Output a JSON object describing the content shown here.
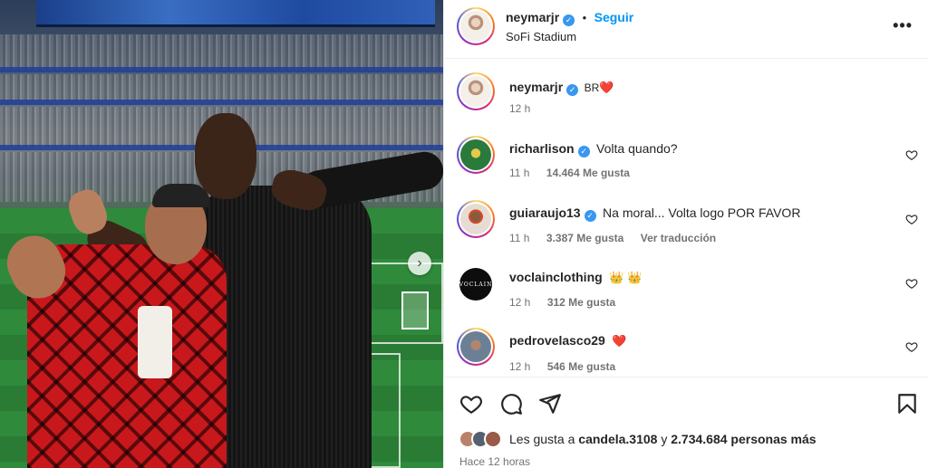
{
  "header": {
    "username": "neymarjr",
    "separator": "•",
    "follow_label": "Seguir",
    "location": "SoFi Stadium",
    "more_icon": "more-horizontal-icon"
  },
  "caption": {
    "username": "neymarjr",
    "text": "BR",
    "emoji": "❤️",
    "time": "12 h"
  },
  "comments": [
    {
      "username": "richarlison",
      "verified": true,
      "text": "Volta quando?",
      "time": "11 h",
      "likes": "14.464 Me gusta",
      "translate": ""
    },
    {
      "username": "guiaraujo13",
      "verified": true,
      "text": "Na moral... Volta logo POR FAVOR",
      "time": "11 h",
      "likes": "3.387 Me gusta",
      "translate": "Ver traducción"
    },
    {
      "username": "voclainclothing",
      "verified": false,
      "text": "",
      "emoji": "👑 👑",
      "time": "12 h",
      "likes": "312 Me gusta",
      "translate": ""
    },
    {
      "username": "pedrovelasco29",
      "verified": false,
      "text": "",
      "emoji": "❤️",
      "time": "12 h",
      "likes": "546 Me gusta",
      "translate": ""
    }
  ],
  "actions": {
    "like_icon": "heart-icon",
    "comment_icon": "comment-icon",
    "share_icon": "share-icon",
    "save_icon": "bookmark-icon"
  },
  "likes": {
    "prefix": "Les gusta a ",
    "first_user": "candela.3108",
    "middle": " y ",
    "others": "2.734.684 personas más"
  },
  "posted": "Hace 12 horas",
  "voclain_logo_text": "VOCLAIN",
  "colors": {
    "accent_blue": "#0095f6",
    "verified_blue": "#3897f0",
    "heart_red": "#ed4956"
  }
}
